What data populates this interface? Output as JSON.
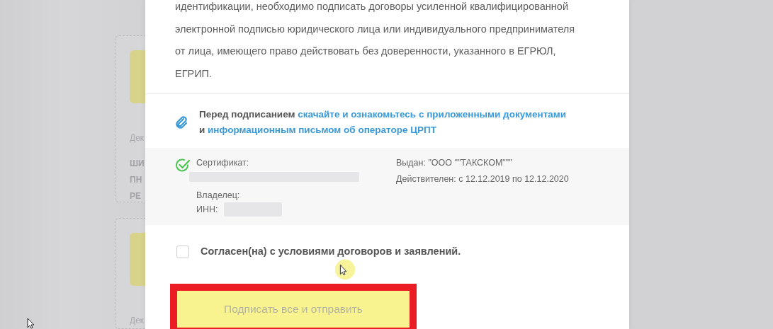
{
  "background_cards": [
    {
      "label": "Дек",
      "title_lines": [
        "ШИ",
        "ПН",
        "РЕ"
      ]
    },
    {
      "label": "Дек"
    }
  ],
  "dialog": {
    "intro": "идентификации, необходимо подписать договоры усиленной квалифицированной\nэлектронной подписью юридического лица или индивидуального предпринимателя\nот лица, имеющего право действовать без доверенности, указанного в ЕГРЮЛ,\nЕГРИП.",
    "attachments": {
      "prefix": "Перед подписанием",
      "link_1": "скачайте и ознакомьтесь с приложенными документами",
      "joiner": "и",
      "link_2": "информационным письмом об операторе ЦРПТ"
    },
    "certificate": {
      "valid": true,
      "certificate_label": "Сертификат:",
      "owner_label": "Владелец:",
      "inn_label": "ИНН:",
      "issuer": "Выдан: \"ООО \"\"ТАКСКОМ\"\"\"",
      "validity": "Действителен: с 12.12.2019 по 12.12.2020"
    },
    "agreement": {
      "label": "Согласен(на) с условиями договоров и заявлений.",
      "checked": false
    },
    "submit": {
      "label": "Подписать все и отправить",
      "disabled": true,
      "highlighted": true
    }
  }
}
